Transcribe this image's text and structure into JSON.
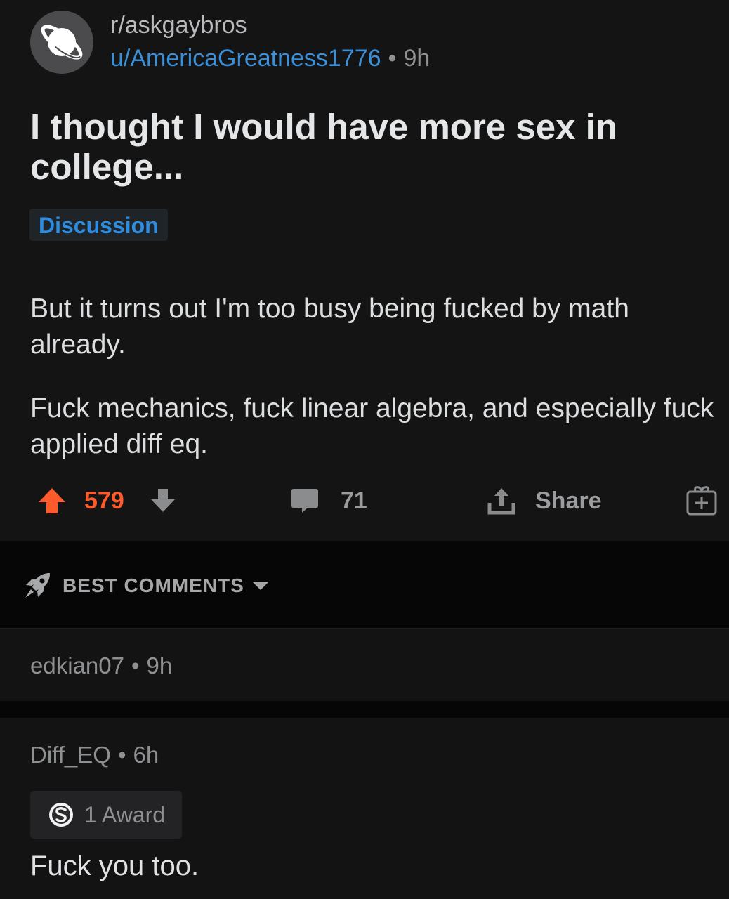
{
  "post": {
    "subreddit": "r/askgaybros",
    "author": "u/AmericaGreatness1776",
    "separator": "•",
    "age": "9h",
    "title": "I thought I would have more sex in college...",
    "flair": "Discussion",
    "body": [
      "But it turns out I'm too busy being fucked by math already.",
      "Fuck mechanics, fuck linear algebra, and especially fuck applied diff eq."
    ],
    "actions": {
      "score": "579",
      "comment_count": "71",
      "share_label": "Share"
    }
  },
  "sort": {
    "label": "BEST COMMENTS"
  },
  "comments": [
    {
      "author": "edkian07",
      "separator": "•",
      "age": "9h"
    },
    {
      "author": "Diff_EQ",
      "separator": "•",
      "age": "6h",
      "award": "1 Award",
      "text": "Fuck you too."
    }
  ],
  "colors": {
    "background": "#131314",
    "upvote": "#ff5a2c",
    "user_link": "#3a8fd9",
    "flair": "#2f8de0"
  },
  "icons": {
    "subreddit_avatar": "planet-icon",
    "upvote": "upvote-arrow-icon",
    "downvote": "downvote-arrow-icon",
    "comments": "comment-bubble-icon",
    "share": "share-icon",
    "award": "gift-box-icon",
    "sort": "rocket-icon",
    "sort_caret": "caret-down-icon",
    "award_badge": "silver-award-icon"
  }
}
